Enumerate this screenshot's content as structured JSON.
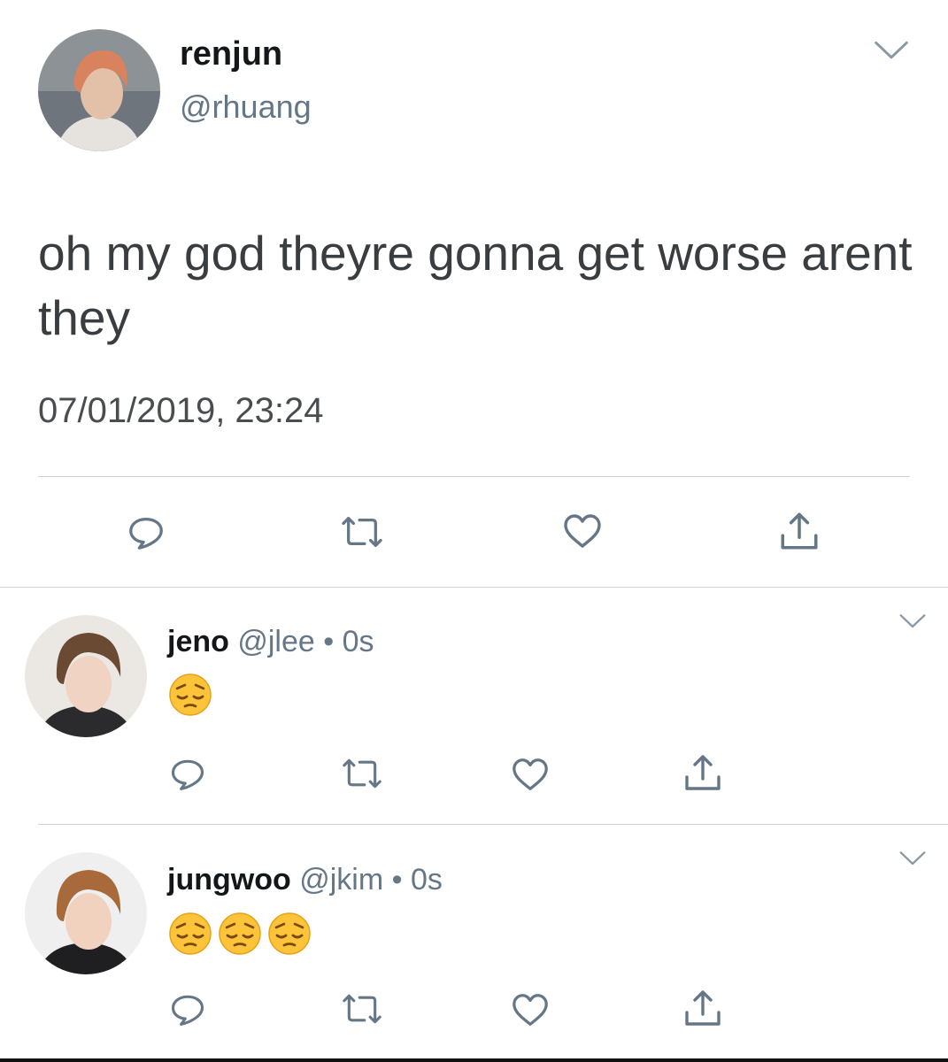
{
  "main_tweet": {
    "author_name": "renjun",
    "author_handle": "@rhuang",
    "text": "oh my god theyre gonna get worse arent they",
    "timestamp": "07/01/2019, 23:24",
    "actions": [
      "reply-icon",
      "retweet-icon",
      "like-icon",
      "share-icon"
    ]
  },
  "replies": [
    {
      "author_name": "jeno",
      "author_handle": "@jlee",
      "separator": "•",
      "time": "0s",
      "emojis": [
        "pensive-face"
      ],
      "actions": [
        "reply-icon",
        "retweet-icon",
        "like-icon",
        "share-icon"
      ]
    },
    {
      "author_name": "jungwoo",
      "author_handle": "@jkim",
      "separator": "•",
      "time": "0s",
      "emojis": [
        "pensive-face",
        "pensive-face",
        "pensive-face"
      ],
      "actions": [
        "reply-icon",
        "retweet-icon",
        "like-icon",
        "share-icon"
      ]
    }
  ],
  "colors": {
    "name": "#14171a",
    "secondary_text": "#657786",
    "tweet_text": "#3a3d40",
    "divider": "#d0d4d8",
    "emoji_yellow": "#fdc43a"
  }
}
